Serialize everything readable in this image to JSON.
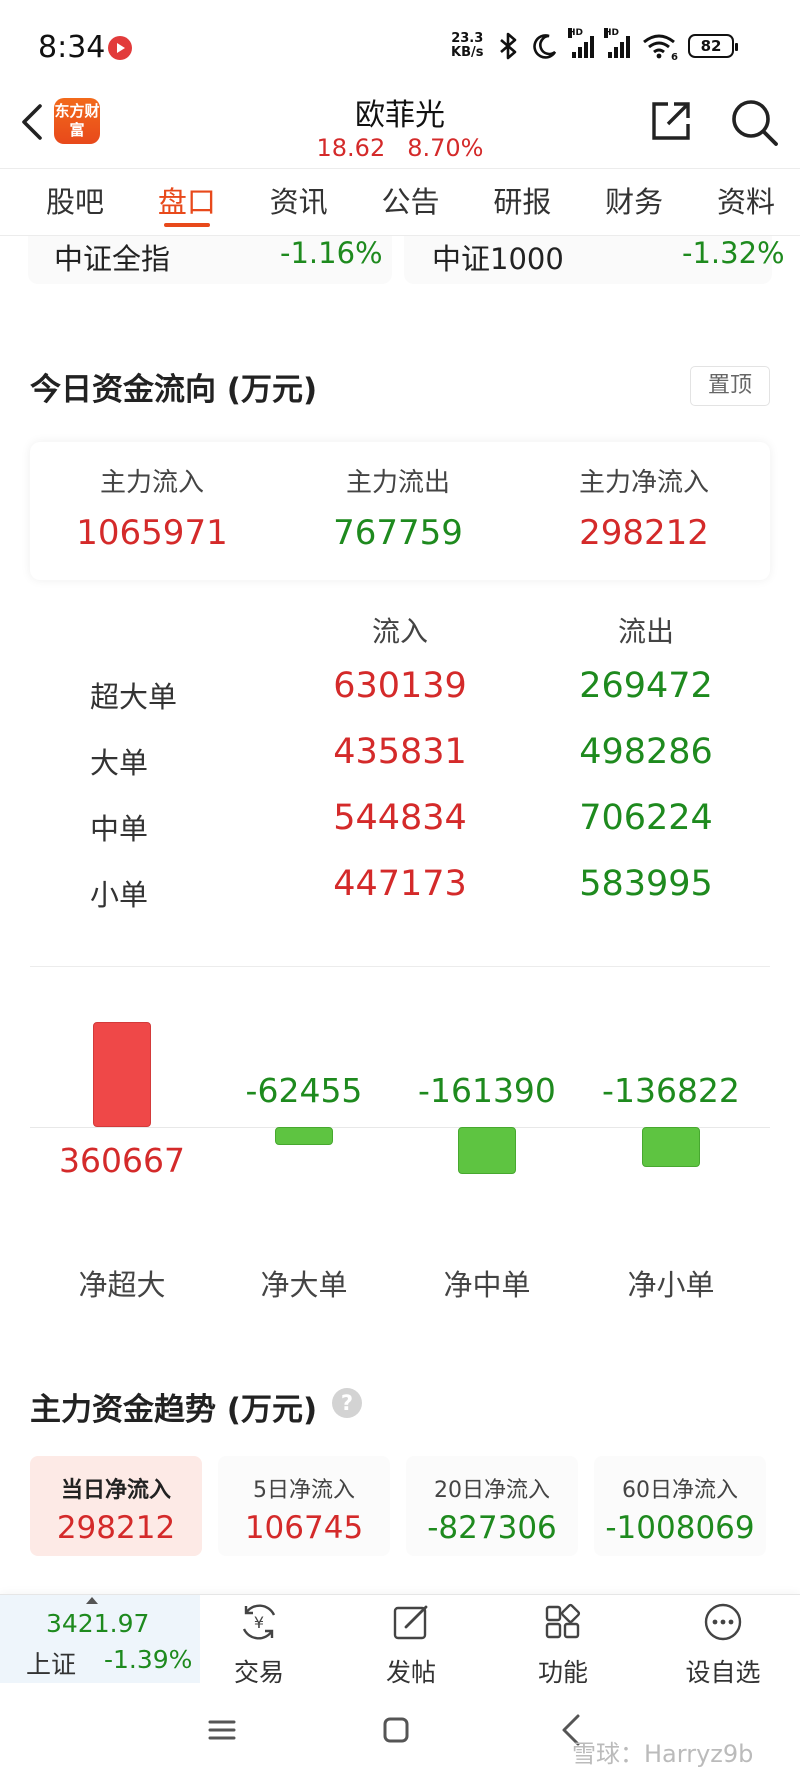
{
  "status_bar": {
    "time": "8:34",
    "net_speed": "23.3",
    "net_unit": "KB/s",
    "signal_1_label": "HD",
    "signal_2_label": "HD",
    "wifi_label": "6",
    "battery": "82"
  },
  "header": {
    "logo_text": "东方财富",
    "stock_name": "欧菲光",
    "price": "18.62",
    "change_pct": "8.70%"
  },
  "tabs": [
    "股吧",
    "盘口",
    "资讯",
    "公告",
    "研报",
    "财务",
    "资料"
  ],
  "active_tab": "盘口",
  "index_strip": [
    {
      "name": "中证全指",
      "value": "-1.16%"
    },
    {
      "name": "中证1000",
      "value": "-1.32%"
    }
  ],
  "fund_flow": {
    "title": "今日资金流向 (万元)",
    "pin_label": "置顶",
    "summary": [
      {
        "label": "主力流入",
        "value": "1065971",
        "color": "#d42a2a"
      },
      {
        "label": "主力流出",
        "value": "767759",
        "color": "#1e8a1e"
      },
      {
        "label": "主力净流入",
        "value": "298212",
        "color": "#d42a2a"
      }
    ],
    "table": {
      "col_in": "流入",
      "col_out": "流出",
      "rows": [
        {
          "label": "超大单",
          "in": "630139",
          "out": "269472"
        },
        {
          "label": "大单",
          "in": "435831",
          "out": "498286"
        },
        {
          "label": "中单",
          "in": "544834",
          "out": "706224"
        },
        {
          "label": "小单",
          "in": "447173",
          "out": "583995"
        }
      ]
    }
  },
  "chart_data": {
    "type": "bar",
    "categories": [
      "净超大",
      "净大单",
      "净中单",
      "净小单"
    ],
    "values": [
      360667,
      -62455,
      -161390,
      -136822
    ],
    "value_labels": [
      "360667",
      "-62455",
      "-161390",
      "-136822"
    ],
    "colors": {
      "positive": "#ef4848",
      "negative": "#5ec441"
    }
  },
  "trend": {
    "title": "主力资金趋势 (万元)",
    "help_icon": "?",
    "cards": [
      {
        "label": "当日净流入",
        "value": "298212",
        "color": "#d42a2a",
        "active": true
      },
      {
        "label": "5日净流入",
        "value": "106745",
        "color": "#d42a2a",
        "active": false
      },
      {
        "label": "20日净流入",
        "value": "-827306",
        "color": "#1e8a1e",
        "active": false
      },
      {
        "label": "60日净流入",
        "value": "-1008069",
        "color": "#1e8a1e",
        "active": false
      }
    ]
  },
  "bottom_nav": {
    "index_price": "3421.97",
    "index_name": "上证",
    "index_change": "-1.39%",
    "items": [
      {
        "label": "交易",
        "icon": "yuan-cycle-icon"
      },
      {
        "label": "发帖",
        "icon": "edit-post-icon"
      },
      {
        "label": "功能",
        "icon": "grid-apps-icon"
      },
      {
        "label": "设自选",
        "icon": "more-dots-icon"
      }
    ]
  },
  "watermark": "雪球：Harryz9b"
}
